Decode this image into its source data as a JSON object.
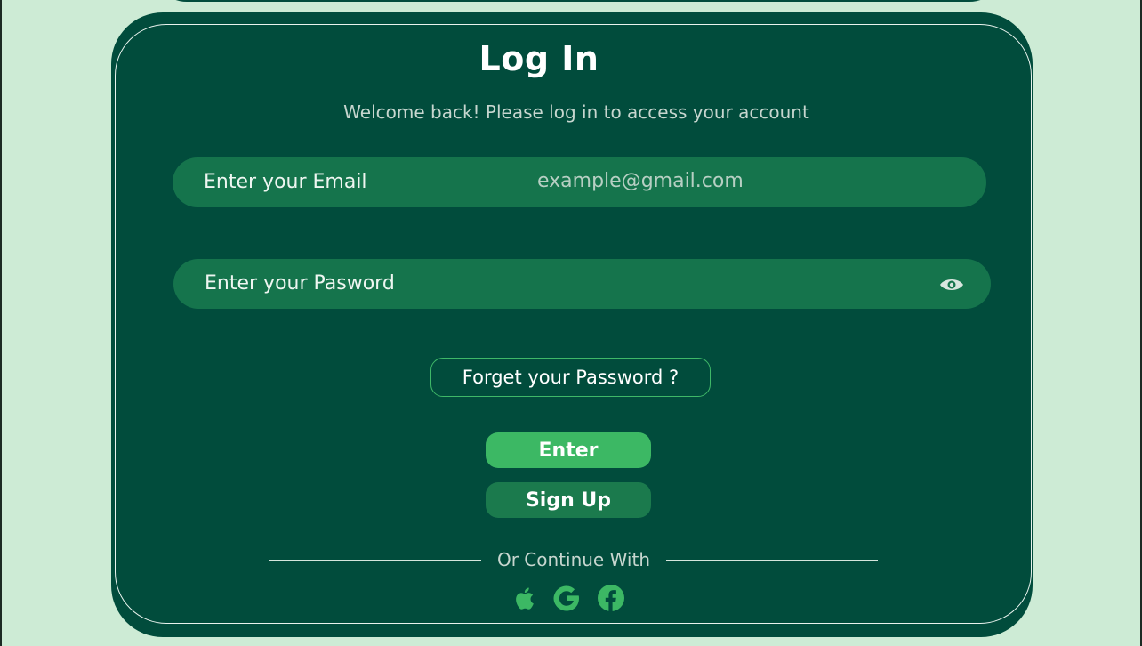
{
  "page": {
    "title": "Log In",
    "subtitle": "Welcome back! Please log in to access your account"
  },
  "email": {
    "label": "Enter your Email",
    "placeholder": "example@gmail.com"
  },
  "password": {
    "label": "Enter your Pasword",
    "toggle_icon": "eye-icon"
  },
  "forgot": {
    "label": "Forget your Password ?"
  },
  "buttons": {
    "enter": "Enter",
    "signup": "Sign Up"
  },
  "social": {
    "label": "Or Continue With",
    "icons": [
      "apple-icon",
      "google-icon",
      "facebook-icon"
    ]
  },
  "colors": {
    "page_background": "#cdebd5",
    "card": "#014c3c",
    "field": "#15744c",
    "accent": "#3cb864",
    "secondary_button": "#1b7a4d"
  }
}
